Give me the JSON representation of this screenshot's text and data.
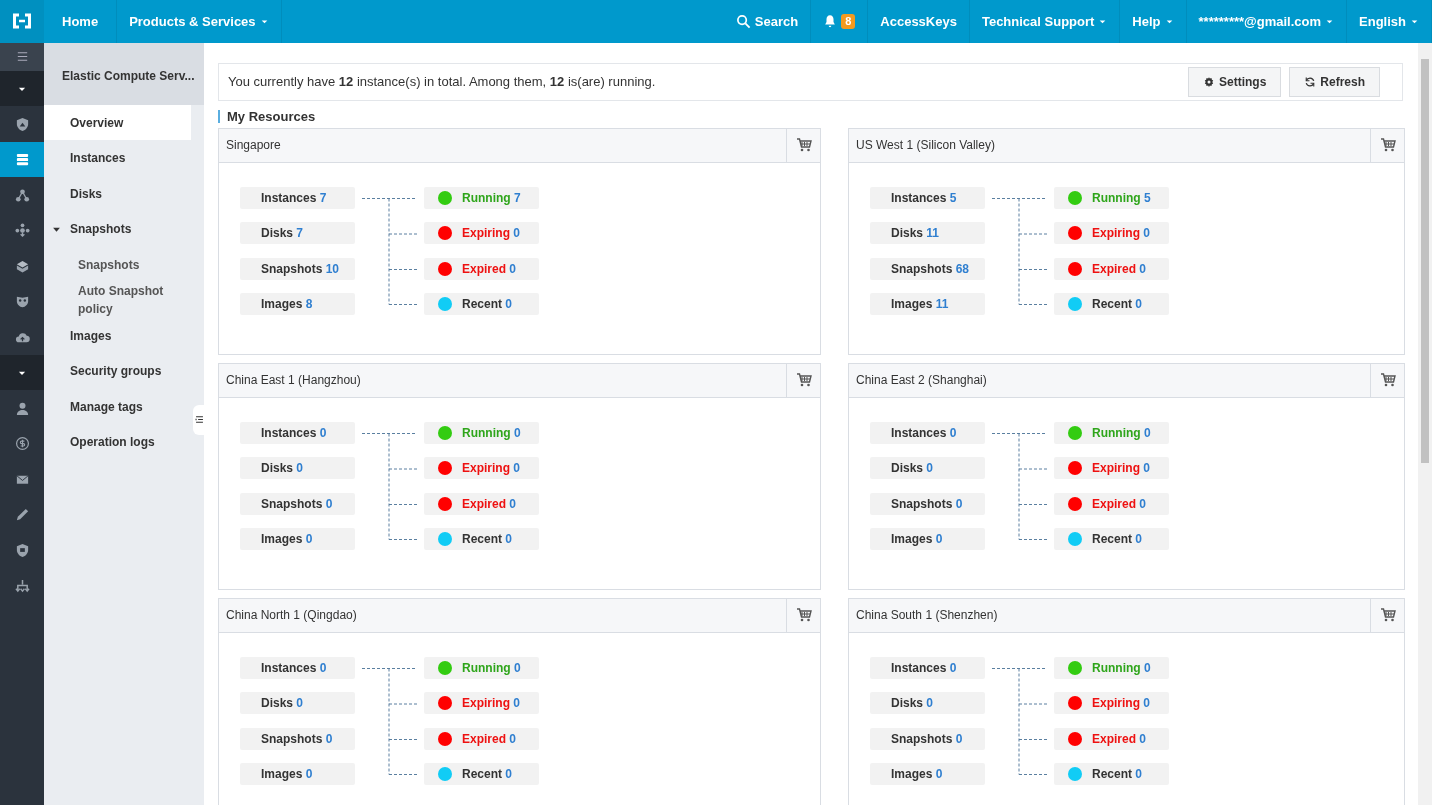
{
  "topbar": {
    "home": "Home",
    "products": "Products & Services",
    "search": "Search",
    "notifications": "8",
    "access_keys": "AccessKeys",
    "support": "Technical Support",
    "help": "Help",
    "account": "*********@gmail.com",
    "language": "English"
  },
  "rail": [
    {
      "kind": "menu",
      "selected": false
    },
    {
      "kind": "caret",
      "selected": false
    },
    {
      "kind": "shield",
      "selected": false
    },
    {
      "kind": "servers",
      "selected": true
    },
    {
      "kind": "nodes",
      "selected": false
    },
    {
      "kind": "network",
      "selected": false
    },
    {
      "kind": "box",
      "selected": false
    },
    {
      "kind": "mask",
      "selected": false
    },
    {
      "kind": "cloud",
      "selected": false
    },
    {
      "kind": "caret",
      "selected": false
    },
    {
      "kind": "user",
      "selected": false
    },
    {
      "kind": "dollar",
      "selected": false
    },
    {
      "kind": "mail",
      "selected": false
    },
    {
      "kind": "pencil",
      "selected": false
    },
    {
      "kind": "badge",
      "selected": false
    },
    {
      "kind": "tree",
      "selected": false
    }
  ],
  "sidebar": {
    "title": "Elastic Compute Serv...",
    "items": [
      {
        "label": "Overview",
        "selected": true
      },
      {
        "label": "Instances",
        "selected": false
      },
      {
        "label": "Disks",
        "selected": false
      },
      {
        "label": "Snapshots",
        "selected": false,
        "expanded": true,
        "children": [
          {
            "label": "Snapshots",
            "selected": false
          },
          {
            "label": "Auto Snapshot policy",
            "selected": false
          }
        ]
      },
      {
        "label": "Images",
        "selected": false
      },
      {
        "label": "Security groups",
        "selected": false
      },
      {
        "label": "Manage tags",
        "selected": false
      },
      {
        "label": "Operation logs",
        "selected": false
      }
    ]
  },
  "summary": {
    "text": "You currently have **12** instance(s) in total. Among them, **12** is(are) running.",
    "buttons": [
      {
        "kind": "settings",
        "label": "Settings"
      },
      {
        "kind": "refresh",
        "label": "Refresh"
      }
    ]
  },
  "section_title": "My Resources",
  "regions": [
    {
      "name": "Singapore",
      "resources": [
        {
          "label": "Instances",
          "count": "7"
        },
        {
          "label": "Disks",
          "count": "7"
        },
        {
          "label": "Snapshots",
          "count": "10"
        },
        {
          "label": "Images",
          "count": "8"
        }
      ],
      "statuses": [
        {
          "kind": "ok",
          "label": "Running",
          "count": "7",
          "color": "#33cc11"
        },
        {
          "kind": "alert",
          "label": "Expiring",
          "count": "0",
          "color": "#ff0000"
        },
        {
          "kind": "alert",
          "label": "Expired",
          "count": "0",
          "color": "#ff0000"
        },
        {
          "kind": "plain",
          "label": "Recent",
          "count": "0",
          "color": "#11ccf5"
        }
      ]
    },
    {
      "name": "US West 1 (Silicon Valley)",
      "resources": [
        {
          "label": "Instances",
          "count": "5"
        },
        {
          "label": "Disks",
          "count": "11"
        },
        {
          "label": "Snapshots",
          "count": "68"
        },
        {
          "label": "Images",
          "count": "11"
        }
      ],
      "statuses": [
        {
          "kind": "ok",
          "label": "Running",
          "count": "5",
          "color": "#33cc11"
        },
        {
          "kind": "alert",
          "label": "Expiring",
          "count": "0",
          "color": "#ff0000"
        },
        {
          "kind": "alert",
          "label": "Expired",
          "count": "0",
          "color": "#ff0000"
        },
        {
          "kind": "plain",
          "label": "Recent",
          "count": "0",
          "color": "#11ccf5"
        }
      ]
    },
    {
      "name": "China East 1 (Hangzhou)",
      "resources": [
        {
          "label": "Instances",
          "count": "0"
        },
        {
          "label": "Disks",
          "count": "0"
        },
        {
          "label": "Snapshots",
          "count": "0"
        },
        {
          "label": "Images",
          "count": "0"
        }
      ],
      "statuses": [
        {
          "kind": "ok",
          "label": "Running",
          "count": "0",
          "color": "#33cc11"
        },
        {
          "kind": "alert",
          "label": "Expiring",
          "count": "0",
          "color": "#ff0000"
        },
        {
          "kind": "alert",
          "label": "Expired",
          "count": "0",
          "color": "#ff0000"
        },
        {
          "kind": "plain",
          "label": "Recent",
          "count": "0",
          "color": "#11ccf5"
        }
      ]
    },
    {
      "name": "China East 2 (Shanghai)",
      "resources": [
        {
          "label": "Instances",
          "count": "0"
        },
        {
          "label": "Disks",
          "count": "0"
        },
        {
          "label": "Snapshots",
          "count": "0"
        },
        {
          "label": "Images",
          "count": "0"
        }
      ],
      "statuses": [
        {
          "kind": "ok",
          "label": "Running",
          "count": "0",
          "color": "#33cc11"
        },
        {
          "kind": "alert",
          "label": "Expiring",
          "count": "0",
          "color": "#ff0000"
        },
        {
          "kind": "alert",
          "label": "Expired",
          "count": "0",
          "color": "#ff0000"
        },
        {
          "kind": "plain",
          "label": "Recent",
          "count": "0",
          "color": "#11ccf5"
        }
      ]
    },
    {
      "name": "China North 1 (Qingdao)",
      "resources": [
        {
          "label": "Instances",
          "count": "0"
        },
        {
          "label": "Disks",
          "count": "0"
        },
        {
          "label": "Snapshots",
          "count": "0"
        },
        {
          "label": "Images",
          "count": "0"
        }
      ],
      "statuses": [
        {
          "kind": "ok",
          "label": "Running",
          "count": "0",
          "color": "#33cc11"
        },
        {
          "kind": "alert",
          "label": "Expiring",
          "count": "0",
          "color": "#ff0000"
        },
        {
          "kind": "alert",
          "label": "Expired",
          "count": "0",
          "color": "#ff0000"
        },
        {
          "kind": "plain",
          "label": "Recent",
          "count": "0",
          "color": "#11ccf5"
        }
      ]
    },
    {
      "name": "China South 1 (Shenzhen)",
      "resources": [
        {
          "label": "Instances",
          "count": "0"
        },
        {
          "label": "Disks",
          "count": "0"
        },
        {
          "label": "Snapshots",
          "count": "0"
        },
        {
          "label": "Images",
          "count": "0"
        }
      ],
      "statuses": [
        {
          "kind": "ok",
          "label": "Running",
          "count": "0",
          "color": "#33cc11"
        },
        {
          "kind": "alert",
          "label": "Expiring",
          "count": "0",
          "color": "#ff0000"
        },
        {
          "kind": "alert",
          "label": "Expired",
          "count": "0",
          "color": "#ff0000"
        },
        {
          "kind": "plain",
          "label": "Recent",
          "count": "0",
          "color": "#11ccf5"
        }
      ]
    }
  ]
}
